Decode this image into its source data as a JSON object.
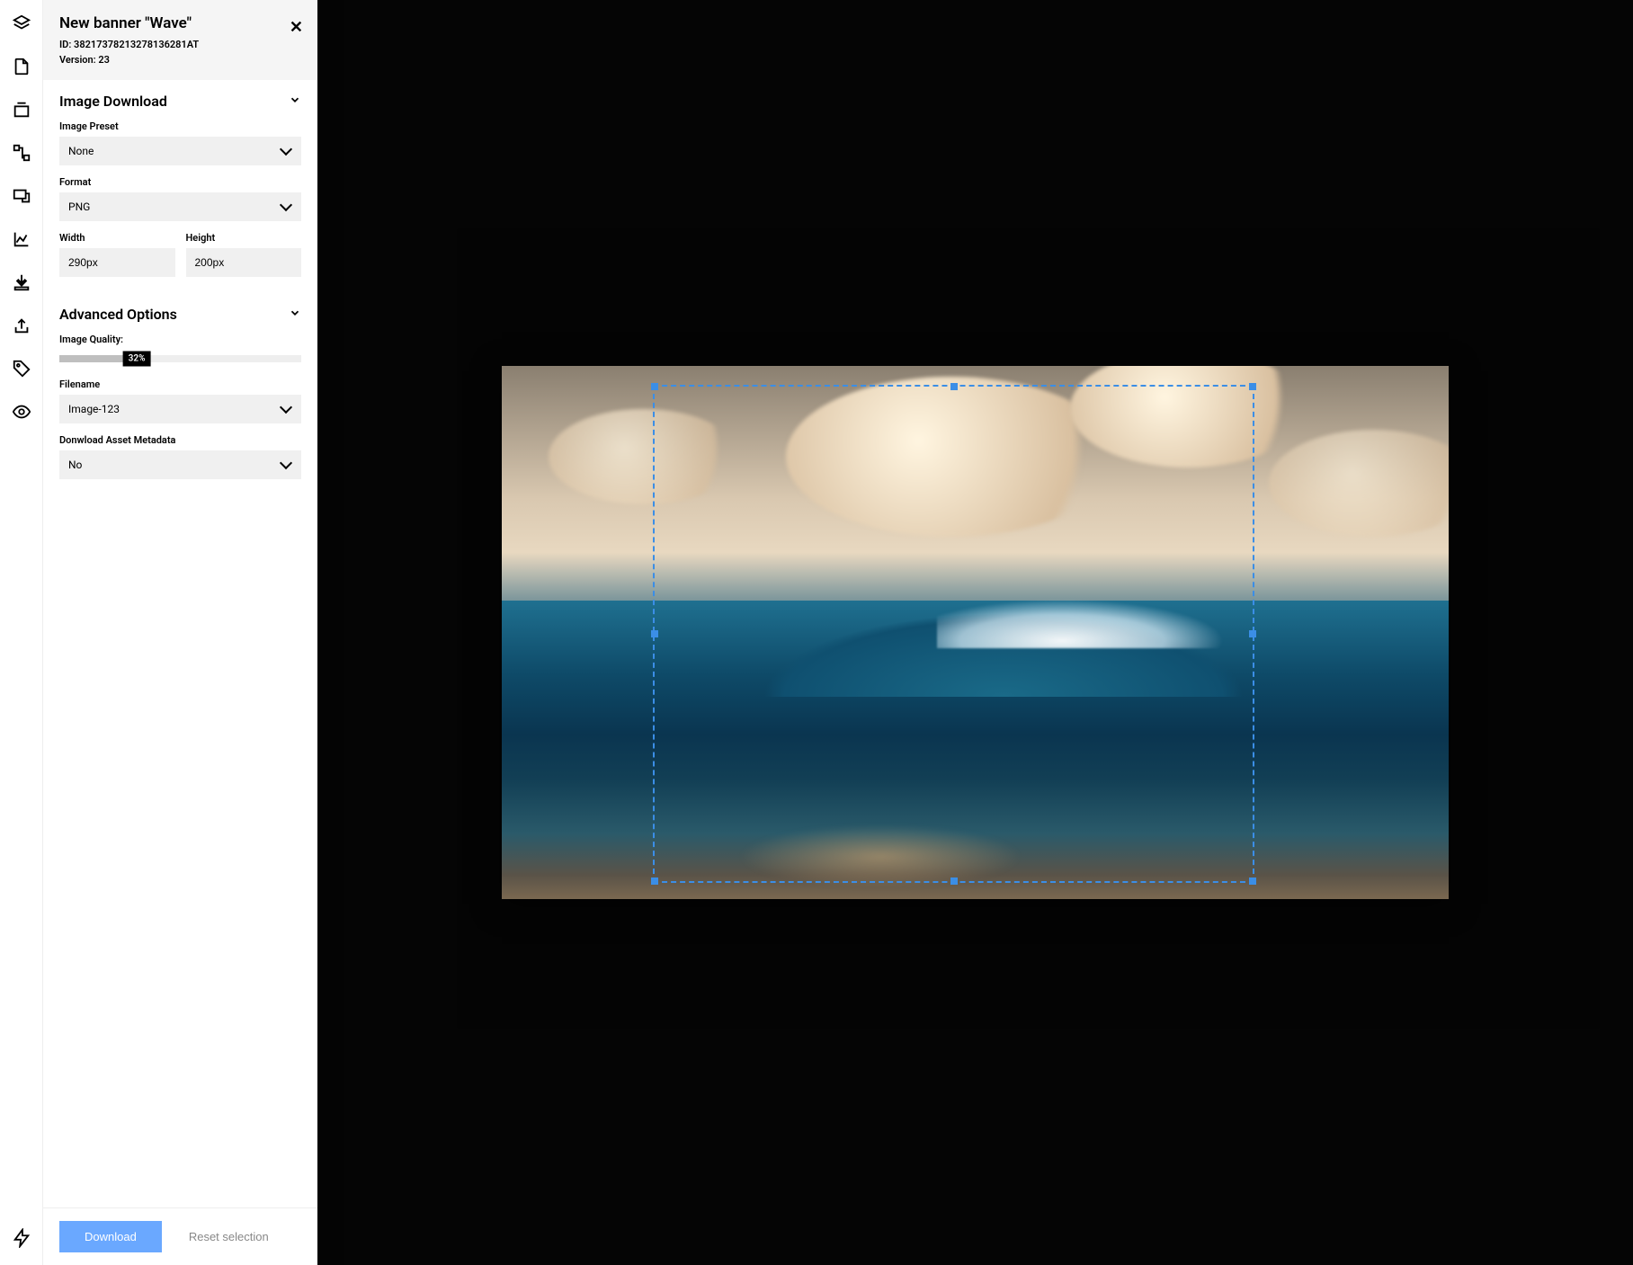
{
  "header": {
    "title": "New banner \"Wave\"",
    "id_label": "ID: 38217378213278136281AT",
    "version_label": "Version: 23"
  },
  "sections": {
    "download": {
      "title": "Image Download",
      "preset_label": "Image Preset",
      "preset_value": "None",
      "format_label": "Format",
      "format_value": "PNG",
      "width_label": "Width",
      "width_value": "290px",
      "height_label": "Height",
      "height_value": "200px"
    },
    "advanced": {
      "title": "Advanced Options",
      "quality_label": "Image Quality:",
      "quality_percent": 32,
      "quality_text": "32%",
      "filename_label": "Filename",
      "filename_value": "Image-123",
      "metadata_label": "Donwload Asset Metadata",
      "metadata_value": "No"
    }
  },
  "footer": {
    "download": "Download",
    "reset": "Reset selection"
  },
  "colors": {
    "accent": "#6aa8ff",
    "crop_border": "#3b8ee6"
  }
}
